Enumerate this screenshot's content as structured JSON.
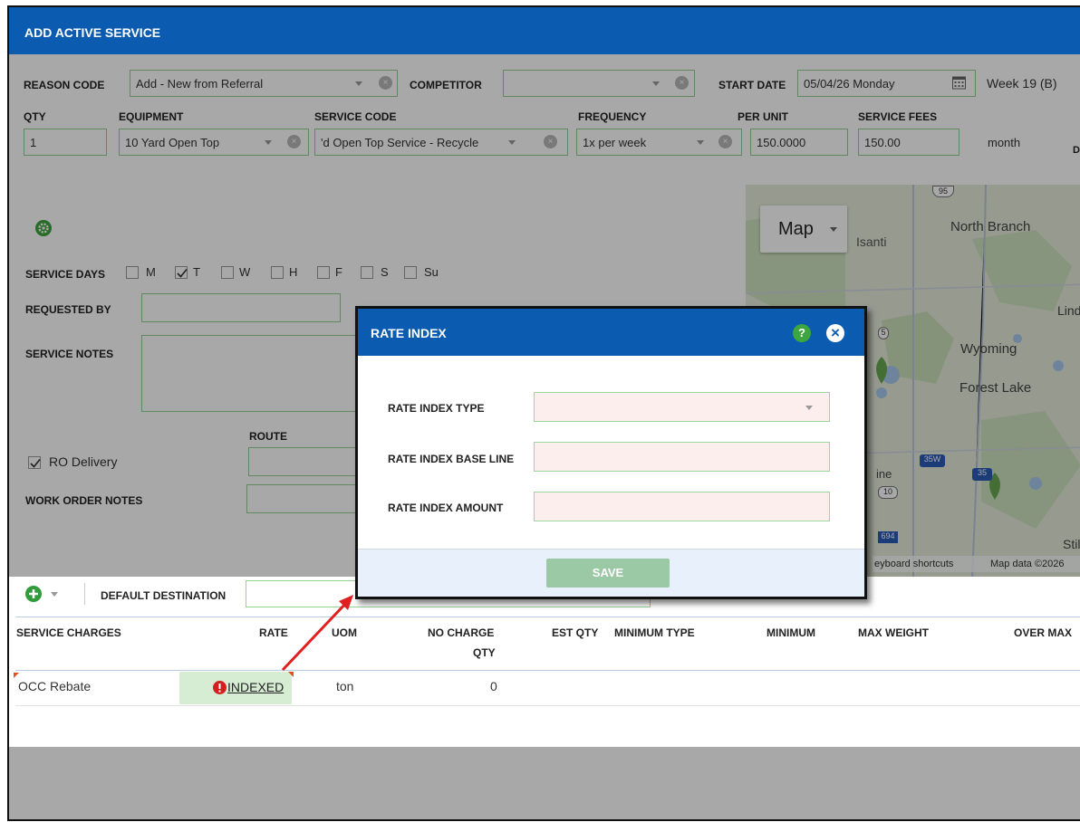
{
  "header": {
    "title": "ADD ACTIVE SERVICE"
  },
  "form": {
    "reason_code": {
      "label": "REASON CODE",
      "value": "Add - New from Referral"
    },
    "competitor": {
      "label": "COMPETITOR",
      "value": ""
    },
    "start_date": {
      "label": "START DATE",
      "value": "05/04/26 Monday",
      "week": "Week 19 (B)"
    },
    "qty": {
      "label": "QTY",
      "value": "1"
    },
    "equipment": {
      "label": "EQUIPMENT",
      "value": "10 Yard Open Top"
    },
    "service_code": {
      "label": "SERVICE CODE",
      "value": "'d Open Top Service - Recycle"
    },
    "frequency": {
      "label": "FREQUENCY",
      "value": "1x per week"
    },
    "per_unit": {
      "label": "PER UNIT",
      "value": "150.0000"
    },
    "service_fees": {
      "label": "SERVICE FEES",
      "value": "150.00",
      "period": "month"
    },
    "service_days": {
      "label": "SERVICE DAYS",
      "days": [
        {
          "label": "M",
          "checked": false
        },
        {
          "label": "T",
          "checked": true
        },
        {
          "label": "W",
          "checked": false
        },
        {
          "label": "H",
          "checked": false
        },
        {
          "label": "F",
          "checked": false
        },
        {
          "label": "S",
          "checked": false
        },
        {
          "label": "Su",
          "checked": false
        }
      ]
    },
    "requested_by": {
      "label": "REQUESTED BY",
      "value": ""
    },
    "service_notes": {
      "label": "SERVICE NOTES",
      "value": ""
    },
    "route": {
      "label": "ROUTE"
    },
    "ro_delivery": {
      "label": "RO Delivery",
      "checked": true
    },
    "work_order_notes": {
      "label": "WORK ORDER NOTES"
    }
  },
  "map": {
    "type_button": "Map",
    "edge_letter": "D",
    "places": [
      "Isanti",
      "North Branch",
      "Lindstr",
      "Wyoming",
      "Forest Lake",
      "ine",
      "Still"
    ],
    "shields": [
      "95",
      "35W",
      "35",
      "10",
      "5",
      "694"
    ],
    "footer_shortcuts": "eyboard shortcuts",
    "footer_data": "Map data ©2026"
  },
  "charges": {
    "default_destination_label": "DEFAULT DESTINATION",
    "columns": {
      "service_charges": "SERVICE CHARGES",
      "rate": "RATE",
      "uom": "UOM",
      "no_charge_qty": [
        "NO CHARGE",
        "QTY"
      ],
      "est_qty": "EST QTY",
      "minimum_type": "MINIMUM TYPE",
      "minimum": "MINIMUM",
      "max_weight": "MAX WEIGHT",
      "over_max": "OVER MAX"
    },
    "rows": [
      {
        "service_charge": "OCC Rebate",
        "rate": "INDEXED",
        "uom": "ton",
        "no_charge_qty": "0"
      }
    ]
  },
  "modal": {
    "title": "RATE INDEX",
    "fields": [
      {
        "label": "RATE INDEX TYPE",
        "value": ""
      },
      {
        "label": "RATE INDEX BASE LINE",
        "value": ""
      },
      {
        "label": "RATE INDEX AMOUNT",
        "value": ""
      }
    ],
    "save_label": "SAVE",
    "help_glyph": "?",
    "close_glyph": "×"
  },
  "colors": {
    "header_blue": "#0b5cb0",
    "field_border": "#93d193",
    "required_fill": "#fdeeee",
    "save_button": "#9bc9a6",
    "error_red": "#d21f1f",
    "help_green": "#3fa53f",
    "arrow_red": "#e02020"
  }
}
